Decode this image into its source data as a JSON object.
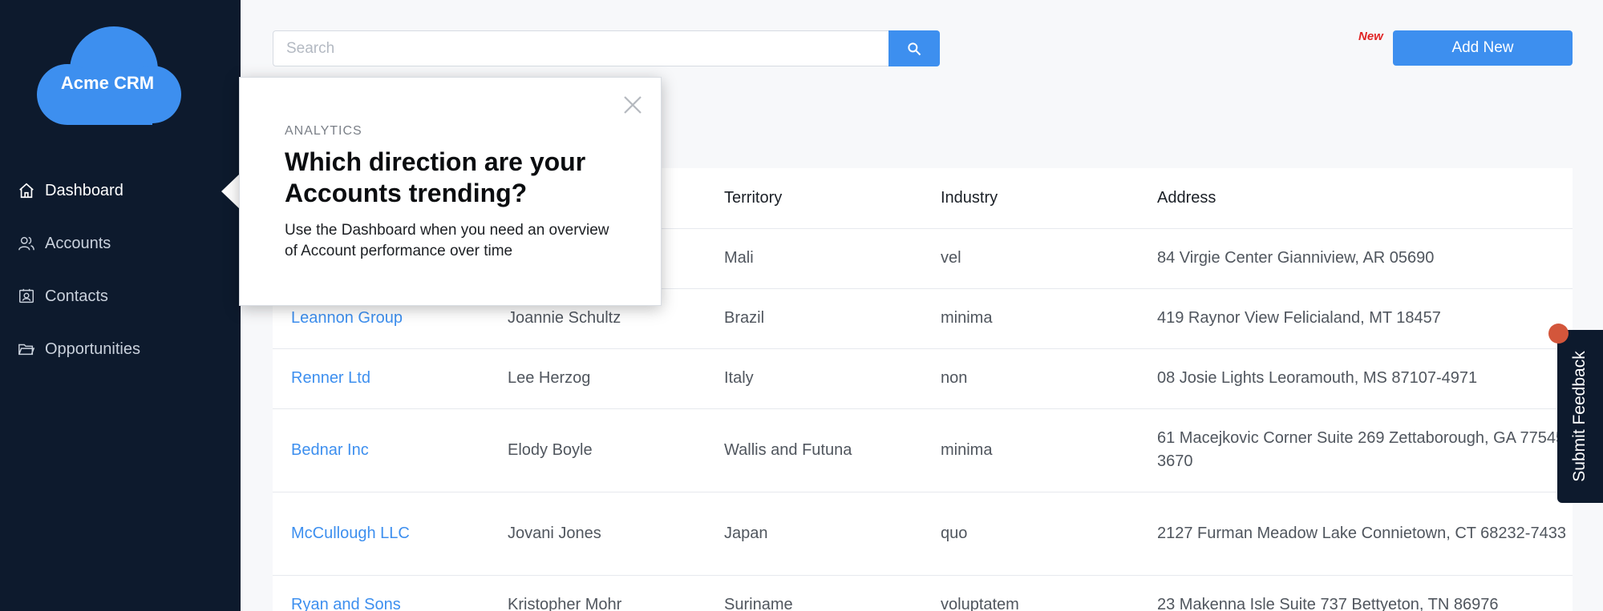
{
  "app": {
    "name": "Acme CRM"
  },
  "sidebar": {
    "items": [
      {
        "label": "Dashboard",
        "icon": "home-icon",
        "active": true
      },
      {
        "label": "Accounts",
        "icon": "users-icon",
        "active": false
      },
      {
        "label": "Contacts",
        "icon": "contact-card-icon",
        "active": false
      },
      {
        "label": "Opportunities",
        "icon": "folder-icon",
        "active": false
      }
    ]
  },
  "search": {
    "placeholder": "Search",
    "value": "",
    "button_icon": "search-icon"
  },
  "header": {
    "new_badge": "New",
    "add_button": "Add New"
  },
  "table": {
    "columns": [
      "",
      "",
      "Territory",
      "Industry",
      "Address"
    ],
    "rows": [
      [
        "",
        "",
        "Mali",
        "vel",
        "84 Virgie Center Gianniview, AR 05690"
      ],
      [
        "Leannon Group",
        "Joannie Schultz",
        "Brazil",
        "minima",
        "419 Raynor View Felicialand, MT 18457"
      ],
      [
        "Renner Ltd",
        "Lee Herzog",
        "Italy",
        "non",
        "08 Josie Lights Leoramouth, MS 87107-4971"
      ],
      [
        "Bednar Inc",
        "Elody Boyle",
        "Wallis and Futuna",
        "minima",
        "61 Macejkovic Corner Suite 269 Zettaborough, GA 77545-3670"
      ],
      [
        "McCullough LLC",
        "Jovani Jones",
        "Japan",
        "quo",
        "2127 Furman Meadow Lake Connietown, CT 68232-7433"
      ],
      [
        "Ryan and Sons",
        "Kristopher Mohr",
        "Suriname",
        "voluptatem",
        "23 Makenna Isle Suite 737 Bettyeton, TN 86976"
      ]
    ]
  },
  "popover": {
    "kicker": "ANALYTICS",
    "title": "Which direction are your Accounts trending?",
    "body": "Use the Dashboard when you need an overview of Account performance over time"
  },
  "feedback": {
    "label": "Submit Feedback"
  },
  "colors": {
    "sidebar_bg": "#0d1a2d",
    "accent": "#3d8fef",
    "badge_red": "#e02424",
    "dot": "#d3563b"
  }
}
